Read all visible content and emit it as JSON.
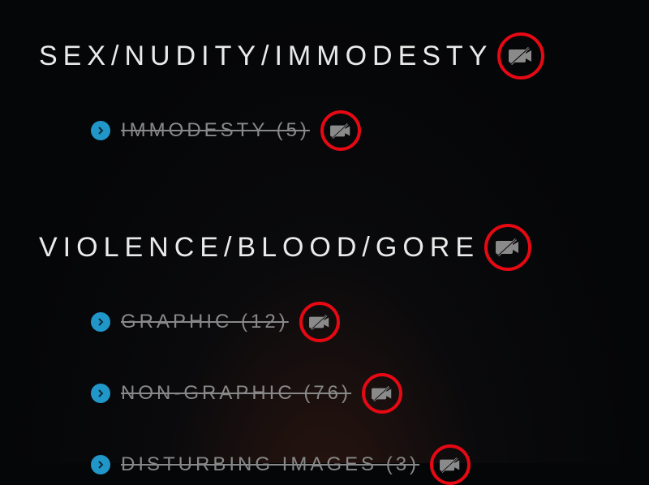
{
  "sections": [
    {
      "title": "SEX/NUDITY/IMMODESTY",
      "items": [
        {
          "label": "IMMODESTY (5)"
        }
      ]
    },
    {
      "title": "VIOLENCE/BLOOD/GORE",
      "items": [
        {
          "label": "GRAPHIC (12)"
        },
        {
          "label": "NON-GRAPHIC (76)"
        },
        {
          "label": "DISTURBING IMAGES (3)"
        }
      ]
    }
  ]
}
